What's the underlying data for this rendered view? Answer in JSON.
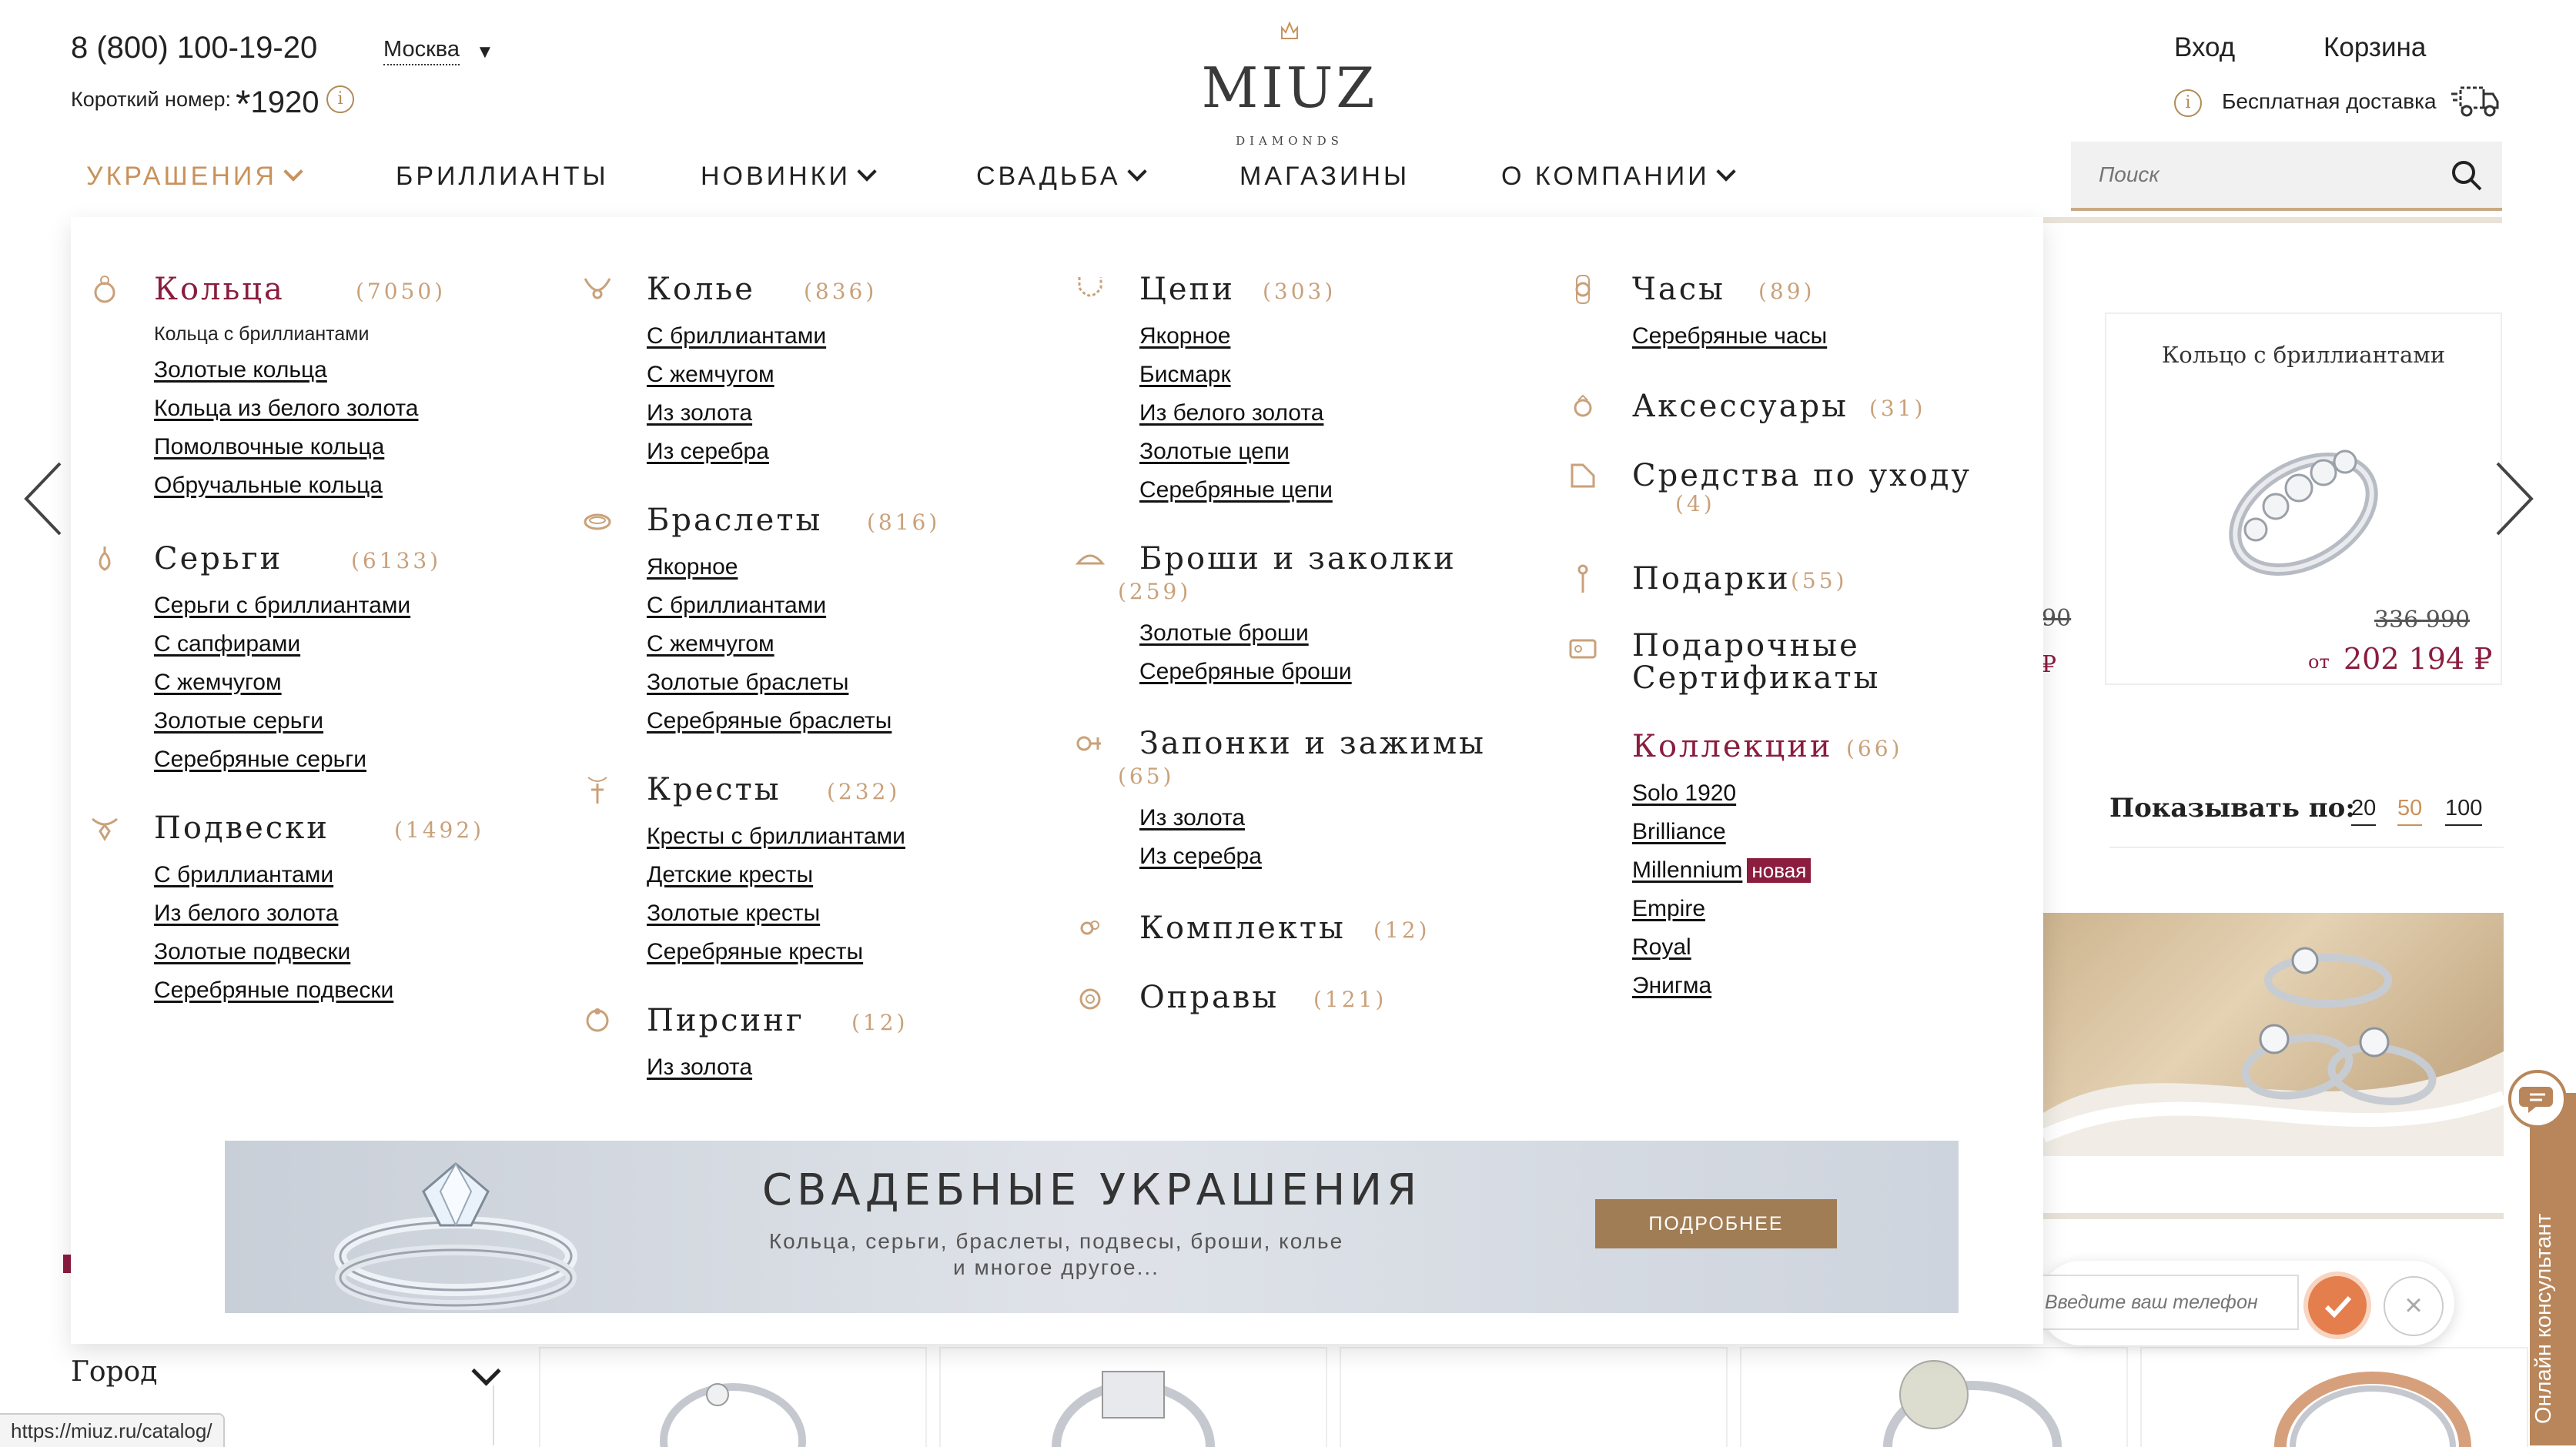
{
  "header": {
    "phone": "8 (800) 100-19-20",
    "short_label": "Короткий номер:",
    "short_star": "*",
    "short_number": "1920",
    "city": "Москва",
    "logo_text": "MIUZ",
    "logo_sub": "DIAMONDS",
    "login": "Вход",
    "cart": "Корзина",
    "shipping": "Бесплатная доставка"
  },
  "nav": [
    {
      "label": "УКРАШЕНИЯ",
      "active": true
    },
    {
      "label": "БРИЛЛИАНТЫ"
    },
    {
      "label": "НОВИНКИ"
    },
    {
      "label": "СВАДЬБА"
    },
    {
      "label": "МАГАЗИНЫ"
    },
    {
      "label": "О КОМПАНИИ"
    }
  ],
  "search": {
    "placeholder": "Поиск"
  },
  "menu": {
    "rings": {
      "title": "Кольца",
      "count": "(7050)",
      "links": [
        "Кольца с бриллиантами",
        "Золотые кольца",
        "Кольца из белого золота",
        "Помолвочные кольца",
        "Обручальные кольца"
      ]
    },
    "earrings": {
      "title": "Серьги",
      "count": "(6133)",
      "links": [
        "Серьги с бриллиантами",
        "С сапфирами",
        "С жемчугом",
        "Золотые серьги",
        "Серебряные серьги"
      ]
    },
    "pendants": {
      "title": "Подвески",
      "count": "(1492)",
      "links": [
        "С бриллиантами",
        "Из белого золота",
        "Золотые подвески",
        "Серебряные подвески"
      ]
    },
    "necklaces": {
      "title": "Колье",
      "count": "(836)",
      "links": [
        "С бриллиантами",
        "С жемчугом",
        "Из золота",
        "Из серебра"
      ]
    },
    "bracelets": {
      "title": "Браслеты",
      "count": "(816)",
      "links": [
        "Якорное",
        "С бриллиантами",
        "С жемчугом",
        "Золотые браслеты",
        "Серебряные браслеты"
      ]
    },
    "crosses": {
      "title": "Кресты",
      "count": "(232)",
      "links": [
        "Кресты с бриллиантами",
        "Детские кресты",
        "Золотые кресты",
        "Серебряные кресты"
      ]
    },
    "piercing": {
      "title": "Пирсинг",
      "count": "(12)",
      "links": [
        "Из золота"
      ]
    },
    "chains": {
      "title": "Цепи",
      "count": "(303)",
      "links": [
        "Якорное",
        "Бисмарк",
        "Из белого золота",
        "Золотые цепи",
        "Серебряные цепи"
      ]
    },
    "brooches": {
      "title": "Броши и заколки",
      "count": "(259)",
      "links": [
        "Золотые броши",
        "Серебряные броши"
      ]
    },
    "cufflinks": {
      "title": "Запонки и зажимы",
      "count": "(65)",
      "links": [
        "Из золота",
        "Из серебра"
      ]
    },
    "sets": {
      "title": "Комплекты",
      "count": "(12)"
    },
    "frames": {
      "title": "Оправы",
      "count": "(121)"
    },
    "watches": {
      "title": "Часы",
      "count": "(89)",
      "links": [
        "Серебряные часы"
      ]
    },
    "accessories": {
      "title": "Аксессуары",
      "count": "(31)"
    },
    "care": {
      "title": "Средства по уходу",
      "count": "(4)"
    },
    "gifts": {
      "title": "Подарки",
      "count": "(55)"
    },
    "certificates": {
      "title": "Подарочные Сертификаты"
    },
    "collections": {
      "title": "Коллекции",
      "count": "(66)",
      "links": [
        "Solo 1920",
        "Brilliance",
        "Millennium",
        "Empire",
        "Royal",
        "Энигма"
      ],
      "badge": "новая"
    }
  },
  "banner": {
    "title": "СВАДЕБНЫЕ УКРАШЕНИЯ",
    "subtitle": "Кольца, серьги, браслеты, подвесы, броши, колье и многое другое...",
    "button": "ПОДРОБНЕЕ"
  },
  "product": {
    "title": "Кольцо с бриллиантами",
    "old_price": "336 990",
    "from": "от",
    "price": "202 194 ₽",
    "partial_old": "90",
    "partial_rub": "₽"
  },
  "show_per_page": {
    "label": "Показывать по:",
    "options": [
      "20",
      "50",
      "100"
    ],
    "selected": "50"
  },
  "filter": {
    "city": "Город"
  },
  "callback": {
    "placeholder": "Введите ваш телефон"
  },
  "consultant": {
    "label": "Онлайн консультант"
  },
  "status_url": "https://miuz.ru/catalog/",
  "colors": {
    "accent": "#c9925b",
    "brand": "#8b1d3f",
    "gold": "#b08b55"
  }
}
